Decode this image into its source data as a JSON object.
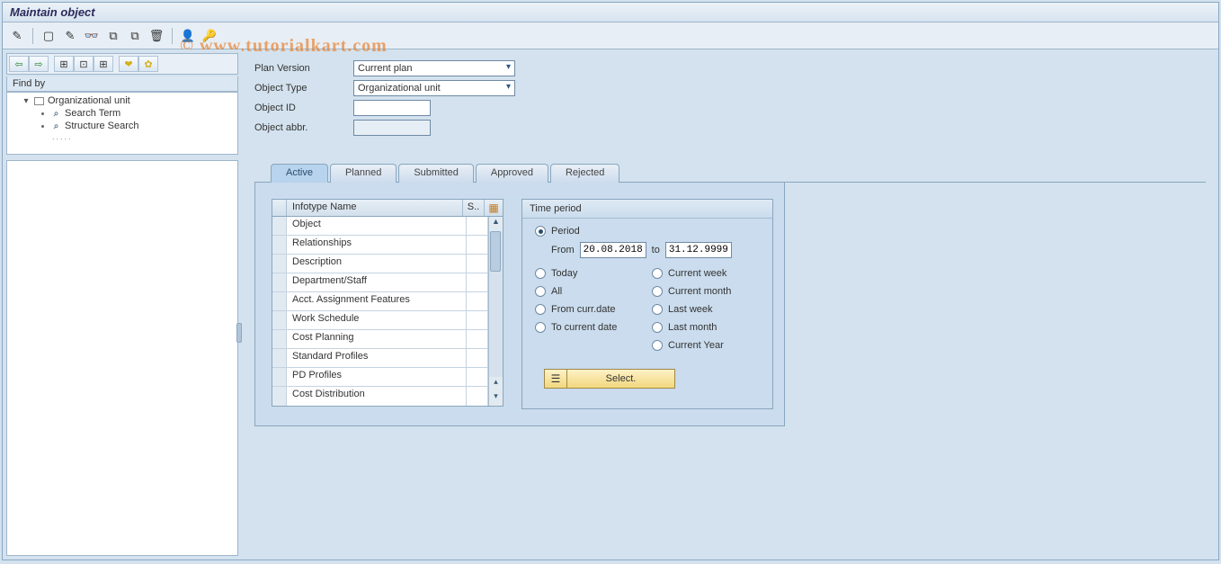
{
  "title": "Maintain object",
  "watermark_prefix": "© ",
  "watermark": "www.tutorialkart.com",
  "sidebar": {
    "findby_label": "Find by",
    "tree": {
      "root": "Organizational unit",
      "items": [
        "Search Term",
        "Structure Search"
      ]
    }
  },
  "form": {
    "plan_version_label": "Plan Version",
    "plan_version_value": "Current plan",
    "object_type_label": "Object Type",
    "object_type_value": "Organizational unit",
    "object_id_label": "Object ID",
    "object_id_value": "",
    "object_abbr_label": "Object abbr.",
    "object_abbr_value": ""
  },
  "tabs": [
    "Active",
    "Planned",
    "Submitted",
    "Approved",
    "Rejected"
  ],
  "infotype": {
    "header_name": "Infotype Name",
    "header_s": "S..",
    "rows": [
      "Object",
      "Relationships",
      "Description",
      "Department/Staff",
      "Acct. Assignment Features",
      "Work Schedule",
      "Cost Planning",
      "Standard Profiles",
      "PD Profiles",
      "Cost Distribution"
    ]
  },
  "time": {
    "title": "Time period",
    "period": "Period",
    "from_label": "From",
    "from_value": "20.08.2018",
    "to_label": "to",
    "to_value": "31.12.9999",
    "options": {
      "today": "Today",
      "curr_week": "Current week",
      "all": "All",
      "curr_month": "Current month",
      "from_curr": "From curr.date",
      "last_week": "Last week",
      "to_curr": "To current date",
      "last_month": "Last month",
      "curr_year": "Current Year"
    },
    "select_btn": "Select."
  }
}
